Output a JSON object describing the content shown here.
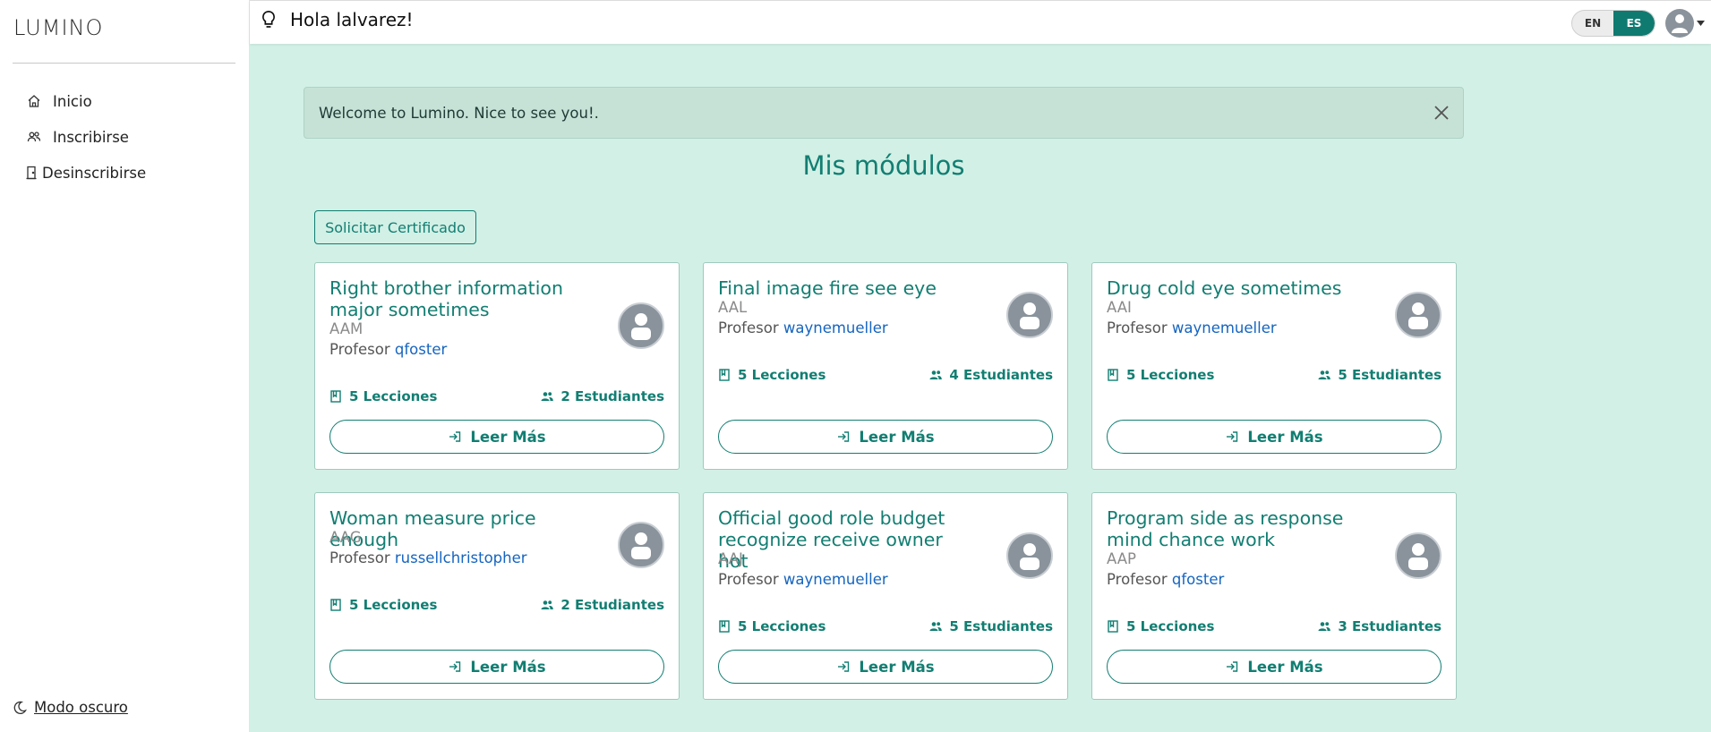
{
  "sidebar": {
    "brand": "LUMINO",
    "items": [
      {
        "label": "Inicio",
        "icon": "home-icon"
      },
      {
        "label": "Inscribirse",
        "icon": "users-icon"
      },
      {
        "label": "Desinscribirse",
        "icon": "door-icon"
      }
    ],
    "dark_mode": "Modo oscuro"
  },
  "header": {
    "greeting": "Hola lalvarez!",
    "lang_en": "EN",
    "lang_es": "ES",
    "active_lang": "ES"
  },
  "alert": {
    "message": "Welcome to Lumino. Nice to see you!."
  },
  "main": {
    "title": "Mis módulos",
    "certificate_button": "Solicitar Certificado",
    "prof_label": "Profesor",
    "read_more": "Leer Más",
    "modules": [
      {
        "title": "Right brother information major sometimes",
        "code": "AAM",
        "professor": "qfoster",
        "lessons": "5 Lecciones",
        "students": "2 Estudiantes"
      },
      {
        "title": "Final image fire see eye",
        "code": "AAL",
        "professor": "waynemueller",
        "lessons": "5 Lecciones",
        "students": "4 Estudiantes"
      },
      {
        "title": "Drug cold eye sometimes",
        "code": "AAI",
        "professor": "waynemueller",
        "lessons": "5 Lecciones",
        "students": "5 Estudiantes"
      },
      {
        "title": "Woman measure price enough",
        "code": "AAG",
        "professor": "russellchristopher",
        "lessons": "5 Lecciones",
        "students": "2 Estudiantes"
      },
      {
        "title": "Official good role budget recognize receive owner hot",
        "code": "AAJ",
        "professor": "waynemueller",
        "lessons": "5 Lecciones",
        "students": "5 Estudiantes"
      },
      {
        "title": "Program side as response mind chance work",
        "code": "AAP",
        "professor": "qfoster",
        "lessons": "5 Lecciones",
        "students": "3 Estudiantes"
      }
    ]
  },
  "colors": {
    "accent": "#127e72",
    "background": "#d2f0e6",
    "link": "#1565c0"
  }
}
